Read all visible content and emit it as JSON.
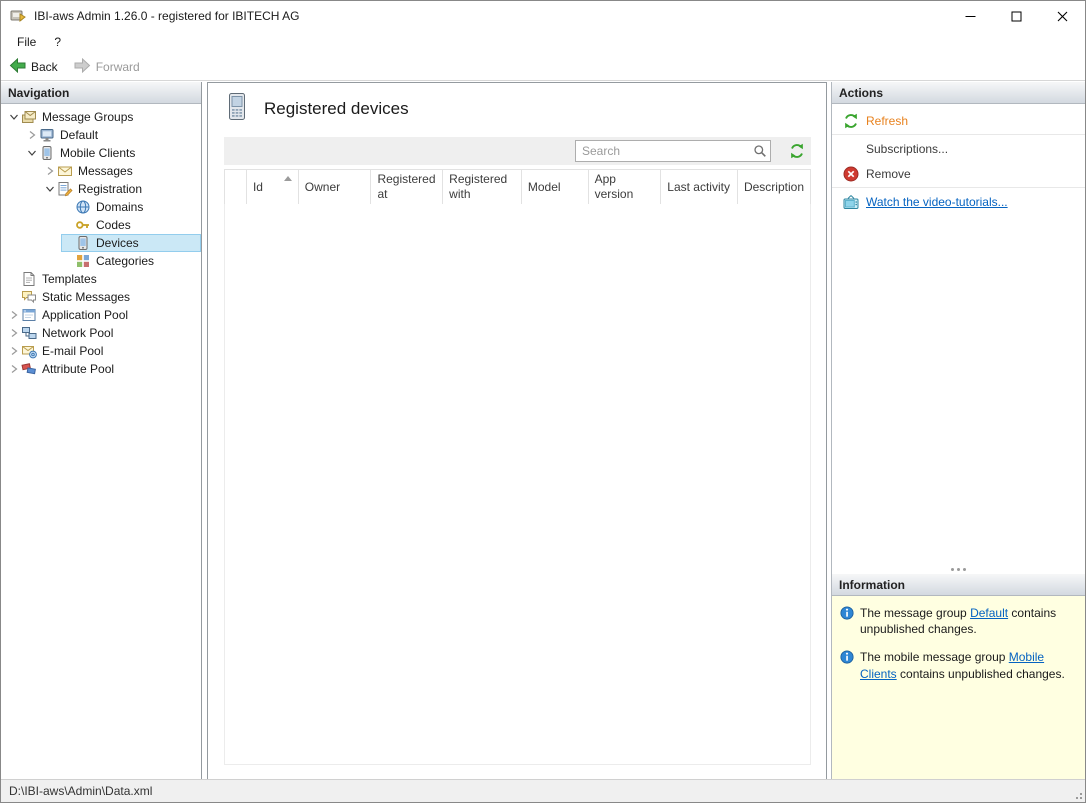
{
  "window": {
    "title": "IBI-aws Admin 1.26.0 - registered for IBITECH AG"
  },
  "menu": {
    "items": [
      {
        "label": "File"
      },
      {
        "label": "?"
      }
    ]
  },
  "toolbar": {
    "back_label": "Back",
    "forward_label": "Forward"
  },
  "navigation": {
    "header": "Navigation",
    "items": [
      {
        "label": "Message Groups",
        "icon": "message-groups-icon",
        "state": "expanded",
        "selected": false
      },
      {
        "label": "Default",
        "icon": "default-group-icon",
        "state": "collapsed",
        "selected": false
      },
      {
        "label": "Mobile Clients",
        "icon": "mobile-clients-icon",
        "state": "expanded",
        "selected": false
      },
      {
        "label": "Messages",
        "icon": "messages-icon",
        "state": "collapsed",
        "selected": false
      },
      {
        "label": "Registration",
        "icon": "registration-icon",
        "state": "expanded",
        "selected": false
      },
      {
        "label": "Domains",
        "icon": "domains-icon",
        "state": "none",
        "selected": false
      },
      {
        "label": "Codes",
        "icon": "codes-icon",
        "state": "none",
        "selected": false
      },
      {
        "label": "Devices",
        "icon": "devices-icon",
        "state": "none",
        "selected": true
      },
      {
        "label": "Categories",
        "icon": "categories-icon",
        "state": "none",
        "selected": false
      },
      {
        "label": "Templates",
        "icon": "templates-icon",
        "state": "none",
        "selected": false
      },
      {
        "label": "Static Messages",
        "icon": "static-messages-icon",
        "state": "none",
        "selected": false
      },
      {
        "label": "Application Pool",
        "icon": "application-pool-icon",
        "state": "collapsed",
        "selected": false
      },
      {
        "label": "Network Pool",
        "icon": "network-pool-icon",
        "state": "collapsed",
        "selected": false
      },
      {
        "label": "E-mail Pool",
        "icon": "email-pool-icon",
        "state": "collapsed",
        "selected": false
      },
      {
        "label": "Attribute Pool",
        "icon": "attribute-pool-icon",
        "state": "collapsed",
        "selected": false
      }
    ]
  },
  "main": {
    "title": "Registered devices",
    "search": {
      "placeholder": "Search",
      "value": ""
    },
    "table": {
      "columns": [
        "Id",
        "Owner",
        "Registered at",
        "Registered with",
        "Model",
        "App version",
        "Last activity",
        "Description"
      ],
      "sort": {
        "column": "Id",
        "direction": "ascending"
      },
      "rows": []
    }
  },
  "actions": {
    "header": "Actions",
    "items": [
      {
        "label": "Refresh",
        "icon": "refresh-icon"
      },
      {
        "label": "Subscriptions...",
        "icon": ""
      },
      {
        "label": "Remove",
        "icon": "remove-icon"
      },
      {
        "label": "Watch the video-tutorials...",
        "icon": "tv-icon"
      }
    ]
  },
  "information": {
    "header": "Information",
    "notes": [
      {
        "prefix": "The message group ",
        "link": "Default",
        "suffix": " contains unpublished changes."
      },
      {
        "prefix": "The mobile message group ",
        "link": "Mobile Clients",
        "suffix": " contains unpublished changes."
      }
    ]
  },
  "statusbar": {
    "path": "D:\\IBI-aws\\Admin\\Data.xml"
  },
  "colors": {
    "selection_bg": "#cbe8f6",
    "info_bg": "#ffffe1",
    "link_blue": "#0563c1",
    "refresh_orange": "#e8821e",
    "icon_green": "#3aa52f"
  }
}
